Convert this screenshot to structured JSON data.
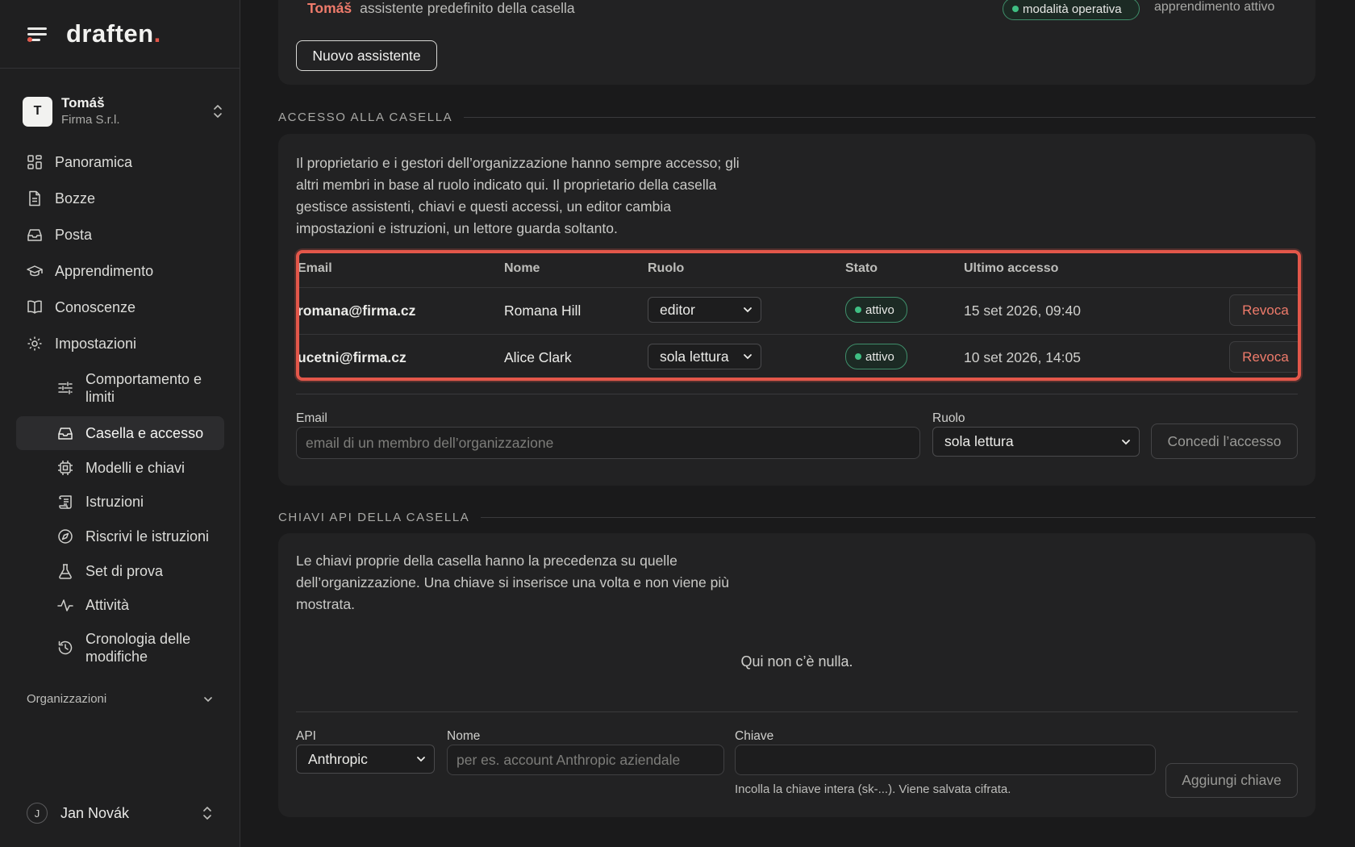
{
  "sidebar": {
    "logo": "draften",
    "logo_dot": ".",
    "account": {
      "initial": "T",
      "name": "Tomáš",
      "org": "Firma S.r.l."
    },
    "nav": [
      {
        "label": "Panoramica",
        "icon": "grid-icon"
      },
      {
        "label": "Bozze",
        "icon": "document-icon"
      },
      {
        "label": "Posta",
        "icon": "inbox-icon"
      },
      {
        "label": "Apprendimento",
        "icon": "graduation-cap-icon"
      },
      {
        "label": "Conoscenze",
        "icon": "book-icon"
      },
      {
        "label": "Impostazioni",
        "icon": "gear-icon"
      }
    ],
    "subnav": [
      {
        "label": "Comportamento e limiti",
        "icon": "sliders-icon"
      },
      {
        "label": "Casella e accesso",
        "icon": "inbox-icon",
        "active": true
      },
      {
        "label": "Modelli e chiavi",
        "icon": "chip-icon"
      },
      {
        "label": "Istruzioni",
        "icon": "scroll-icon"
      },
      {
        "label": "Riscrivi le istruzioni",
        "icon": "compass-icon"
      },
      {
        "label": "Set di prova",
        "icon": "flask-icon"
      },
      {
        "label": "Attività",
        "icon": "activity-icon"
      },
      {
        "label": "Cronologia delle modifiche",
        "icon": "history-icon"
      }
    ],
    "organizations_label": "Organizzazioni",
    "user": {
      "initial": "J",
      "name": "Jan Novák"
    }
  },
  "assistants": {
    "top_row": {
      "name": "Tomáš",
      "description": "assistente predefinito della casella",
      "mode_badge": "modalità operativa",
      "learning": "apprendimento attivo"
    },
    "new_button": "Nuovo assistente"
  },
  "access": {
    "section_title": "ACCESSO ALLA CASELLA",
    "description_lines": [
      "Il proprietario e i gestori dell’organizzazione hanno sempre accesso; gli",
      "altri membri in base al ruolo indicato qui. Il proprietario della casella",
      "gestisce assistenti, chiavi e questi accessi, un editor cambia",
      "impostazioni e istruzioni, un lettore guarda soltanto."
    ],
    "columns": [
      "Email",
      "Nome",
      "Ruolo",
      "Stato",
      "Ultimo accesso"
    ],
    "rows": [
      {
        "email": "romana@firma.cz",
        "name": "Romana Hill",
        "role": "editor",
        "status": "attivo",
        "last": "15 set 2026, 09:40",
        "action": "Revoca"
      },
      {
        "email": "ucetni@firma.cz",
        "name": "Alice Clark",
        "role": "sola lettura",
        "status": "attivo",
        "last": "10 set 2026, 14:05",
        "action": "Revoca"
      }
    ],
    "form": {
      "email_label": "Email",
      "email_placeholder": "email di un membro dell’organizzazione",
      "role_label": "Ruolo",
      "role_value": "sola lettura",
      "submit": "Concedi l’accesso"
    }
  },
  "api_keys": {
    "section_title": "CHIAVI API DELLA CASELLA",
    "description_lines": [
      "Le chiavi proprie della casella hanno la precedenza su quelle",
      "dell’organizzazione. Una chiave si inserisce una volta e non viene più",
      "mostrata."
    ],
    "empty": "Qui non c’è nulla.",
    "form": {
      "api_label": "API",
      "api_value": "Anthropic",
      "name_label": "Nome",
      "name_placeholder": "per es. account Anthropic aziendale",
      "key_label": "Chiave",
      "key_hint": "Incolla la chiave intera (sk-...). Viene salvata cifrata.",
      "submit": "Aggiungi chiave"
    }
  },
  "colors": {
    "accent": "#e3574a",
    "status_green": "#3fbf83",
    "revoke": "#ef7b6b"
  }
}
